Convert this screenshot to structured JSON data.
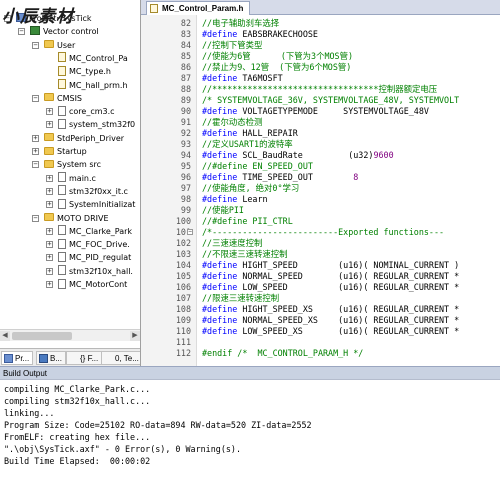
{
  "watermark": "小辰素材",
  "project_tree": [
    {
      "label": "Project: SysTick",
      "kind": "root",
      "expander": "−"
    },
    {
      "label": "Vector control",
      "kind": "target",
      "expander": "−"
    },
    {
      "label": "User",
      "kind": "folder",
      "expander": "−"
    },
    {
      "label": "MC_Control_Pa",
      "kind": "file",
      "expander": ""
    },
    {
      "label": "MC_type.h",
      "kind": "file",
      "expander": ""
    },
    {
      "label": "MC_hall_prm.h",
      "kind": "file",
      "expander": ""
    },
    {
      "label": "CMSIS",
      "kind": "folder",
      "expander": "−"
    },
    {
      "label": "core_cm3.c",
      "kind": "file",
      "expander": "+"
    },
    {
      "label": "system_stm32f0",
      "kind": "file",
      "expander": "+"
    },
    {
      "label": "StdPeriph_Driver",
      "kind": "folder",
      "expander": "+"
    },
    {
      "label": "Startup",
      "kind": "folder",
      "expander": "+"
    },
    {
      "label": "System src",
      "kind": "folder",
      "expander": "−"
    },
    {
      "label": "main.c",
      "kind": "file",
      "expander": "+"
    },
    {
      "label": "stm32f0xx_it.c",
      "kind": "file",
      "expander": "+"
    },
    {
      "label": "SystemInitializat",
      "kind": "file",
      "expander": "+"
    },
    {
      "label": "MOTO DRIVE",
      "kind": "folder",
      "expander": "−"
    },
    {
      "label": "MC_Clarke_Park",
      "kind": "file",
      "expander": "+"
    },
    {
      "label": "MC_FOC_Drive.",
      "kind": "file",
      "expander": "+"
    },
    {
      "label": "MC_PID_regulat",
      "kind": "file",
      "expander": "+"
    },
    {
      "label": "stm32f10x_hall.",
      "kind": "file",
      "expander": "+"
    },
    {
      "label": "MC_MotorCont",
      "kind": "file",
      "expander": "+"
    }
  ],
  "project_tabs": [
    {
      "label": "Pr..."
    },
    {
      "label": "B..."
    },
    {
      "label": "{} F..."
    },
    {
      "label": "0, Te..."
    }
  ],
  "editor": {
    "tab_label": "MC_Control_Param.h",
    "lines": [
      {
        "n": "82",
        "fold": "",
        "segs": [
          {
            "c": "cm",
            "t": "//电子辅助刹车选择"
          }
        ]
      },
      {
        "n": "83",
        "fold": "",
        "segs": [
          {
            "c": "kw",
            "t": "#define"
          },
          {
            "c": "tx",
            "t": " EABSBRAKECHOOSE"
          }
        ]
      },
      {
        "n": "84",
        "fold": "",
        "segs": [
          {
            "c": "cm",
            "t": "//控制下管类型"
          }
        ]
      },
      {
        "n": "85",
        "fold": "",
        "segs": [
          {
            "c": "cm",
            "t": "//使能为6管      (下管为3个MOS管)"
          }
        ]
      },
      {
        "n": "86",
        "fold": "",
        "segs": [
          {
            "c": "cm",
            "t": "//禁止为9、12管  (下管为6个MOS管)"
          }
        ]
      },
      {
        "n": "87",
        "fold": "",
        "segs": [
          {
            "c": "kw",
            "t": "#define"
          },
          {
            "c": "tx",
            "t": " TA6MOSFT"
          }
        ]
      },
      {
        "n": "88",
        "fold": "",
        "segs": [
          {
            "c": "cm",
            "t": "//*********************************控制器额定电压"
          }
        ]
      },
      {
        "n": "89",
        "fold": "",
        "segs": [
          {
            "c": "cm",
            "t": "/* SYSTEMVOLTAGE_36V, SYSTEMVOLTAGE_48V, SYSTEMVOLT"
          }
        ]
      },
      {
        "n": "90",
        "fold": "",
        "segs": [
          {
            "c": "kw",
            "t": "#define"
          },
          {
            "c": "tx",
            "t": " VOLTAGETYPEMODE     SYSTEMVOLTAGE_48V"
          }
        ]
      },
      {
        "n": "91",
        "fold": "",
        "segs": [
          {
            "c": "cm",
            "t": "//霍尔动态检测"
          }
        ]
      },
      {
        "n": "92",
        "fold": "",
        "segs": [
          {
            "c": "kw",
            "t": "#define"
          },
          {
            "c": "tx",
            "t": " HALL_REPAIR"
          }
        ]
      },
      {
        "n": "93",
        "fold": "",
        "segs": [
          {
            "c": "cm",
            "t": "//定义USART1的波特率"
          }
        ]
      },
      {
        "n": "94",
        "fold": "",
        "segs": [
          {
            "c": "kw",
            "t": "#define"
          },
          {
            "c": "tx",
            "t": " SCL_BaudRate         (u32)"
          },
          {
            "c": "num",
            "t": "9600"
          }
        ]
      },
      {
        "n": "95",
        "fold": "",
        "segs": [
          {
            "c": "cm",
            "t": "//#define EN_SPEED_OUT"
          }
        ]
      },
      {
        "n": "96",
        "fold": "",
        "segs": [
          {
            "c": "kw",
            "t": "#define"
          },
          {
            "c": "tx",
            "t": " TIME_SPEED_OUT        "
          },
          {
            "c": "num",
            "t": "8"
          }
        ]
      },
      {
        "n": "97",
        "fold": "",
        "segs": [
          {
            "c": "cm",
            "t": "//使能角度, 绝对0°学习"
          }
        ]
      },
      {
        "n": "98",
        "fold": "",
        "segs": [
          {
            "c": "kw",
            "t": "#define"
          },
          {
            "c": "tx",
            "t": " Learn"
          }
        ]
      },
      {
        "n": "99",
        "fold": "",
        "segs": [
          {
            "c": "cm",
            "t": "//使能PII"
          }
        ]
      },
      {
        "n": "100",
        "fold": "",
        "segs": [
          {
            "c": "cm",
            "t": "//#define PII_CTRL"
          }
        ]
      },
      {
        "n": "101",
        "fold": "−",
        "segs": [
          {
            "c": "cm",
            "t": "/*-------------------------Exported functions---"
          }
        ]
      },
      {
        "n": "102",
        "fold": "",
        "segs": [
          {
            "c": "cm",
            "t": "//三速速度控制"
          }
        ]
      },
      {
        "n": "103",
        "fold": "",
        "segs": [
          {
            "c": "cm",
            "t": "//不限速三速转速控制"
          }
        ]
      },
      {
        "n": "104",
        "fold": "",
        "segs": [
          {
            "c": "kw",
            "t": "#define"
          },
          {
            "c": "tx",
            "t": " HIGHT_SPEED        (u16)( NOMINAL_CURRENT )"
          }
        ]
      },
      {
        "n": "105",
        "fold": "",
        "segs": [
          {
            "c": "kw",
            "t": "#define"
          },
          {
            "c": "tx",
            "t": " NORMAL_SPEED       (u16)( REGULAR_CURRENT *"
          }
        ]
      },
      {
        "n": "106",
        "fold": "",
        "segs": [
          {
            "c": "kw",
            "t": "#define"
          },
          {
            "c": "tx",
            "t": " LOW_SPEED          (u16)( REGULAR_CURRENT *"
          }
        ]
      },
      {
        "n": "107",
        "fold": "",
        "segs": [
          {
            "c": "cm",
            "t": "//限速三速转速控制"
          }
        ]
      },
      {
        "n": "108",
        "fold": "",
        "segs": [
          {
            "c": "kw",
            "t": "#define"
          },
          {
            "c": "tx",
            "t": " HIGHT_SPEED_XS     (u16)( REGULAR_CURRENT *"
          }
        ]
      },
      {
        "n": "109",
        "fold": "",
        "segs": [
          {
            "c": "kw",
            "t": "#define"
          },
          {
            "c": "tx",
            "t": " NORMAL_SPEED_XS    (u16)( REGULAR_CURRENT *"
          }
        ]
      },
      {
        "n": "110",
        "fold": "",
        "segs": [
          {
            "c": "kw",
            "t": "#define"
          },
          {
            "c": "tx",
            "t": " LOW_SPEED_XS       (u16)( REGULAR_CURRENT *"
          }
        ]
      },
      {
        "n": "111",
        "fold": "",
        "segs": []
      },
      {
        "n": "112",
        "fold": "",
        "segs": [
          {
            "c": "cm",
            "t": "#endif /*  MC_CONTROL_PARAM_H */"
          }
        ]
      }
    ]
  },
  "output": {
    "title": "Build Output",
    "lines": [
      "compiling MC_Clarke_Park.c...",
      "compiling stm32f10x_hall.c...",
      "linking...",
      "Program Size: Code=25102 RO-data=894 RW-data=520 ZI-data=2552",
      "FromELF: creating hex file...",
      "\".\\obj\\SysTick.axf\" - 0 Error(s), 0 Warning(s).",
      "Build Time Elapsed:  00:00:02"
    ]
  }
}
